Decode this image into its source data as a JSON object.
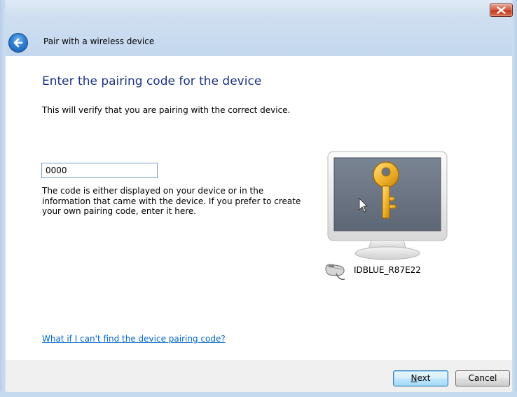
{
  "window": {
    "title": "Pair with a wireless device",
    "close_icon": "close-icon",
    "back_icon": "back-arrow-icon",
    "accent": "#1e3287"
  },
  "main": {
    "heading": "Enter the pairing code for the device",
    "subtitle": "This will verify that you are pairing with the correct device.",
    "code_value": "0000",
    "help_text": "The code is either displayed on your device or in the information that came with the device. If you prefer to create your own pairing code, enter it here.",
    "device_name": "IDBLUE_R87E22",
    "device_icon": "mouse-icon",
    "illustration_icon": "monitor-key-icon",
    "help_link": "What if I can't find the device pairing code?"
  },
  "footer": {
    "next_label": "Next",
    "next_accelerator": "N",
    "cancel_label": "Cancel"
  }
}
